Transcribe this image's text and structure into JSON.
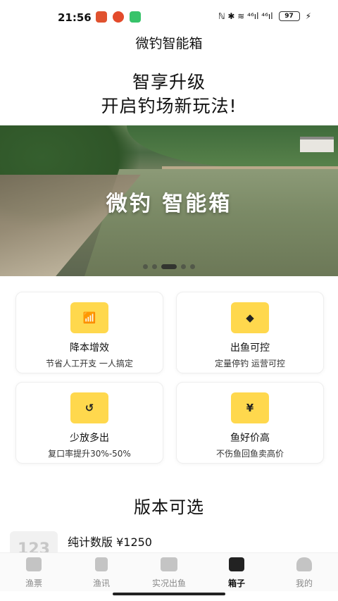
{
  "status_bar": {
    "time": "21:56",
    "indicators": "ℕ ✱ ≋ ⁴⁶ıl ⁴⁶ıl",
    "battery": "97",
    "charging_glyph": "⚡",
    "app_icons": [
      "app-icon-orange",
      "app-icon-red",
      "app-icon-green"
    ],
    "app_colors": [
      "#e0522f",
      "#e34b2c",
      "#37c36a"
    ]
  },
  "app_title": "微钓智能箱",
  "headline": {
    "line1": "智享升级",
    "line2": "开启钓场新玩法!"
  },
  "banner": {
    "text": "微钓  智能箱",
    "slide_count": 5,
    "active_slide": 3
  },
  "features": [
    {
      "icon": "chart-up-icon",
      "glyph": "📶",
      "title": "降本增效",
      "subtitle": "节省人工开支 一人搞定"
    },
    {
      "icon": "fish-icon",
      "glyph": "◆",
      "title": "出鱼可控",
      "subtitle": "定量停钓 运营可控"
    },
    {
      "icon": "refresh-icon",
      "glyph": "↺",
      "title": "少放多出",
      "subtitle": "复口率提升30%-50%"
    },
    {
      "icon": "yen-icon",
      "glyph": "¥",
      "title": "鱼好价高",
      "subtitle": "不伤鱼回鱼卖高价"
    }
  ],
  "accent_color": "#ffd84d",
  "versions": {
    "title": "版本可选",
    "items": [
      {
        "thumb": "123",
        "label": "纯计数版 ¥1250"
      }
    ]
  },
  "bottom_nav": {
    "items": [
      {
        "label": "渔票",
        "icon": "ticket-icon"
      },
      {
        "label": "渔讯",
        "icon": "news-icon"
      },
      {
        "label": "实况出鱼",
        "icon": "live-video-icon"
      },
      {
        "label": "箱子",
        "icon": "box-icon",
        "active": true
      },
      {
        "label": "我的",
        "icon": "profile-icon"
      }
    ]
  }
}
